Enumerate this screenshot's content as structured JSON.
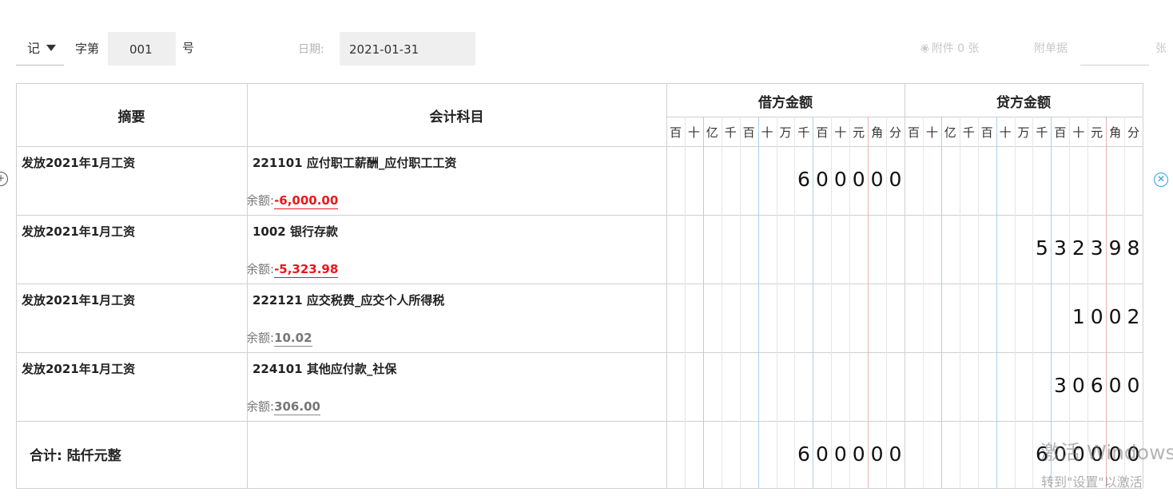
{
  "header": {
    "voucher_type": "记",
    "zi_di_label": "字第",
    "voucher_number": "001",
    "hao_label": "号",
    "date_label": "日期:",
    "date_value": "2021-01-31",
    "attachment_label": "附件 0 张",
    "fudanju_label": "附单据",
    "fudanju_value": "",
    "zhang_label": "张"
  },
  "table": {
    "col_summary": "摘要",
    "col_account": "会计科目",
    "col_debit": "借方金额",
    "col_credit": "贷方金额",
    "units": [
      "百",
      "十",
      "亿",
      "千",
      "百",
      "十",
      "万",
      "千",
      "百",
      "十",
      "元",
      "角",
      "分"
    ],
    "rows": [
      {
        "summary": "发放2021年1月工资",
        "account": "221101 应付职工薪酬_应付职工工资",
        "balance_label": "余额:",
        "balance": "-6,000.00",
        "balance_negative": true,
        "debit": "600000",
        "credit": ""
      },
      {
        "summary": "发放2021年1月工资",
        "account": "1002 银行存款",
        "balance_label": "余额:",
        "balance": "-5,323.98",
        "balance_negative": true,
        "debit": "",
        "credit": "532398"
      },
      {
        "summary": "发放2021年1月工资",
        "account": "222121 应交税费_应交个人所得税",
        "balance_label": "余额:",
        "balance": "10.02",
        "balance_negative": false,
        "debit": "",
        "credit": "1002"
      },
      {
        "summary": "发放2021年1月工资",
        "account": "224101 其他应付款_社保",
        "balance_label": "余额:",
        "balance": "306.00",
        "balance_negative": false,
        "debit": "",
        "credit": "30600"
      }
    ],
    "total_label": "合计:  陆仟元整",
    "total_debit": "600000",
    "total_credit": "600000"
  },
  "icons": {
    "left_row_action": "plus-circle-icon",
    "right_row_action": "close-circle-icon",
    "attachment": "paperclip-icon"
  },
  "colors": {
    "negative_balance": "#e8191a",
    "accent": "#2aa0ea",
    "grid_blue": "#a8d0ef",
    "grid_red": "#e8b4b4"
  },
  "watermark": {
    "line1": "激活 Windows",
    "line2": "转到\"设置\"以激活"
  }
}
